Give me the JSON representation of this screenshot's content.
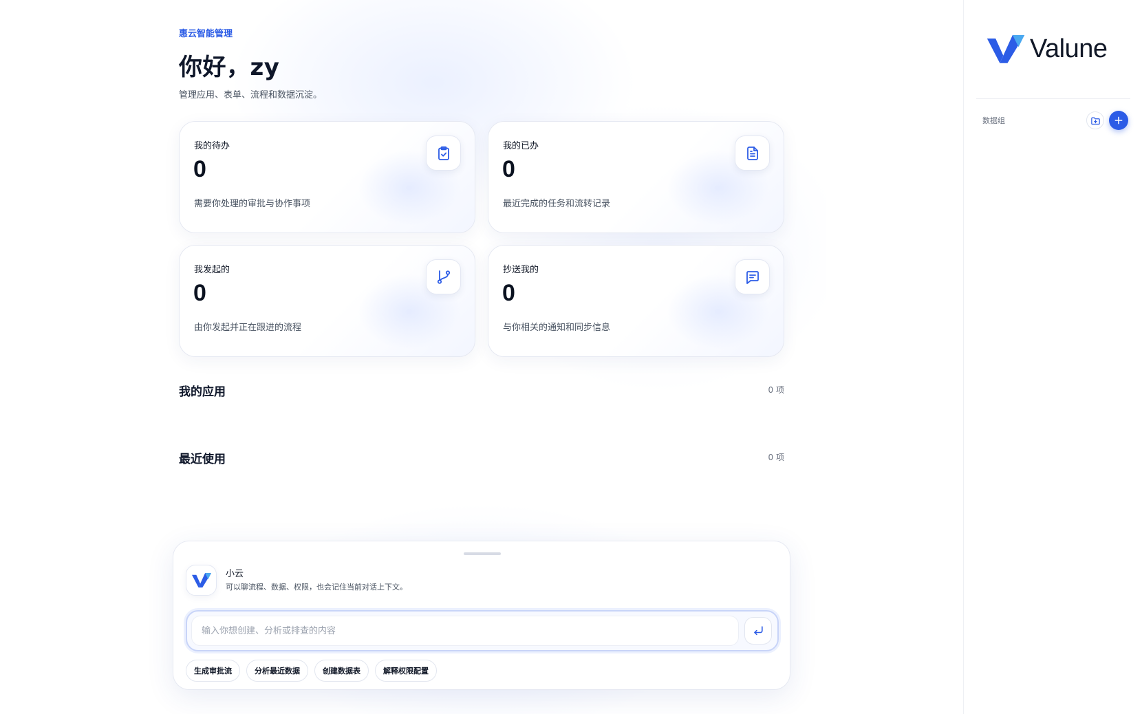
{
  "brand": {
    "subtitle": "惠云智能管理",
    "logo_text": "Valune"
  },
  "header": {
    "greeting": "你好，zy",
    "tagline": "管理应用、表单、流程和数据沉淀。"
  },
  "cards": [
    {
      "title": "我的待办",
      "value": "0",
      "desc": "需要你处理的审批与协作事项",
      "icon": "clipboard-check-icon"
    },
    {
      "title": "我的已办",
      "value": "0",
      "desc": "最近完成的任务和流转记录",
      "icon": "document-icon"
    },
    {
      "title": "我发起的",
      "value": "0",
      "desc": "由你发起并正在跟进的流程",
      "icon": "git-branch-icon"
    },
    {
      "title": "抄送我的",
      "value": "0",
      "desc": "与你相关的通知和同步信息",
      "icon": "message-icon"
    }
  ],
  "sections": {
    "my_apps": {
      "title": "我的应用",
      "count": "0 项"
    },
    "recent": {
      "title": "最近使用",
      "count": "0 项"
    }
  },
  "assistant": {
    "name": "小云",
    "desc": "可以聊流程、数据、权限，也会记住当前对话上下文。",
    "input_placeholder": "输入你想创建、分析或排查的内容",
    "input_value": "",
    "chips": [
      "生成审批流",
      "分析最近数据",
      "创建数据表",
      "解释权限配置"
    ]
  },
  "sidebar": {
    "group_label": "数据组"
  },
  "colors": {
    "accent": "#2c5ce6",
    "accent_light": "#4aa8f0",
    "text": "#111827",
    "muted": "#4b5563"
  }
}
